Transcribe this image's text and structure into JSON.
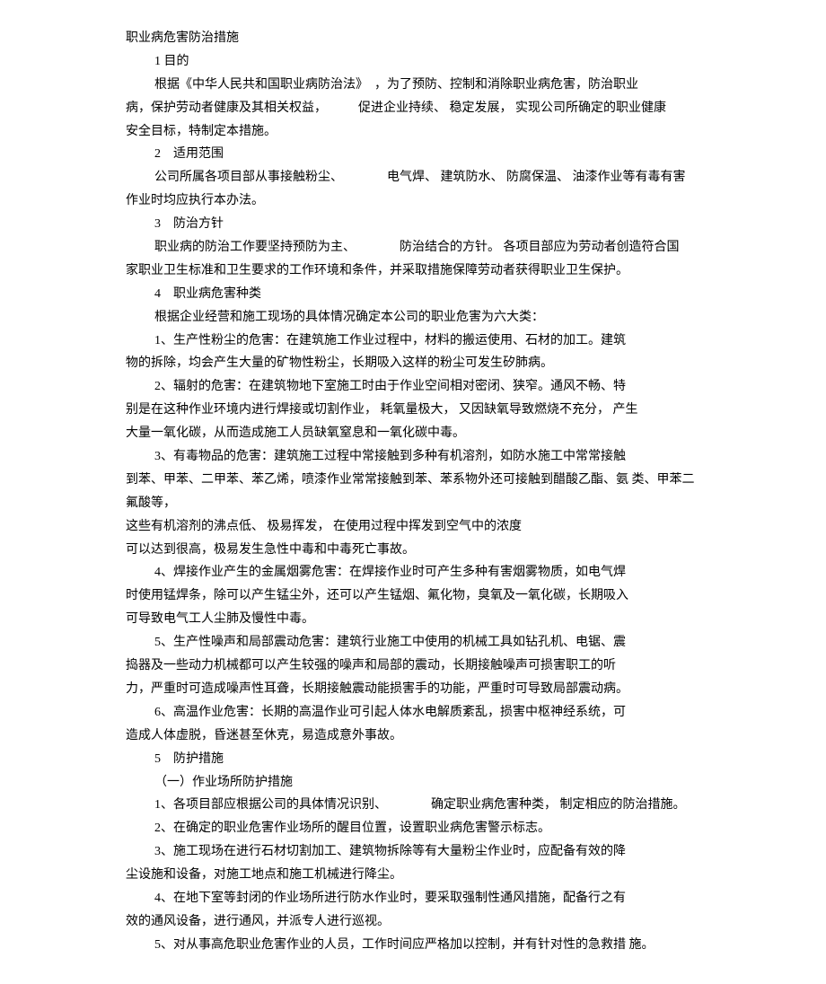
{
  "title": "职业病危害防治措施",
  "sections": {
    "s1": {
      "head": "1 目的",
      "p1": "根据《中华人民共和国职业病防治法》　，为了预防、控制和消除职业病危害，防治职业",
      "p2": "病，保护劳动者健康及其相关权益，　　　促进企业持续、 稳定发展， 实现公司所确定的职业健康",
      "p3": "安全目标，特制定本措施。"
    },
    "s2": {
      "head": "2　适用范围",
      "p1": "公司所属各项目部从事接触粉尘、　　　　电气焊、 建筑防水、 防腐保温、 油漆作业等有毒有害",
      "p2": "作业时均应执行本办法。"
    },
    "s3": {
      "head": "3　防治方针",
      "p1": "职业病的防治工作要坚持预防为主、　　　　防治结合的方针。 各项目部应为劳动者创造符合国",
      "p2": "家职业卫生标准和卫生要求的工作环境和条件，并采取措施保障劳动者获得职业卫生保护。"
    },
    "s4": {
      "head": "4　职业病危害种类",
      "intro": "根据企业经营和施工现场的具体情况确定本公司的职业危害为六大类：",
      "item1a": "1、生产性粉尘的危害：在建筑施工作业过程中，材料的搬运使用、石材的加工。建筑",
      "item1b": "物的拆除，均会产生大量的矿物性粉尘，长期吸入这样的粉尘可发生矽肺病。",
      "item2a": "2、辐射的危害：在建筑物地下室施工时由于作业空间相对密闭、狭窄。通风不畅、特",
      "item2b": "别是在这种作业环境内进行焊接或切割作业， 耗氧量极大， 又因缺氧导致燃烧不充分， 产生",
      "item2c": "大量一氧化碳，从而造成施工人员缺氧窒息和一氧化碳中毒。",
      "item3a": "3、有毒物品的危害：建筑施工过程中常接触到多种有机溶剂，如防水施工中常常接触",
      "item3b": "到苯、甲苯、二甲苯、苯乙烯，喷漆作业常常接触到苯、苯系物外还可接触到醋酸乙酯、氨 类、甲苯二氟酸等，",
      "item3c": "这些有机溶剂的沸点低、 极易挥发， 在使用过程中挥发到空气中的浓度",
      "item3d": "可以达到很高，极易发生急性中毒和中毒死亡事故。",
      "item4a": "4、焊接作业产生的金属烟雾危害：在焊接作业时可产生多种有害烟雾物质，如电气焊",
      "item4b": "时使用锰焊条，除可以产生锰尘外，还可以产生锰烟、氟化物，臭氧及一氧化碳，长期吸入",
      "item4c": "可导致电气工人尘肺及慢性中毒。",
      "item5a": "5、生产性噪声和局部震动危害：建筑行业施工中使用的机械工具如钻孔机、电锯、震",
      "item5b": "捣器及一些动力机械都可以产生较强的噪声和局部的震动，长期接触噪声可损害职工的听",
      "item5c": "力，严重时可造成噪声性耳聋，长期接触震动能损害手的功能，严重时可导致局部震动病。",
      "item6a": "6、高温作业危害：长期的高温作业可引起人体水电解质紊乱，损害中枢神经系统，可",
      "item6b": "造成人体虚脱，昏迷甚至休克，易造成意外事故。"
    },
    "s5": {
      "head": "5　防护措施",
      "sub": "（一）作业场所防护措施",
      "item1": "1、各项目部应根据公司的具体情况识别、　　　　确定职业病危害种类， 制定相应的防治措施。",
      "item2": "2、在确定的职业危害作业场所的醒目位置，设置职业病危害警示标志。",
      "item3a": "3、施工现场在进行石材切割加工、建筑物拆除等有大量粉尘作业时，应配备有效的降",
      "item3b": "尘设施和设备，对施工地点和施工机械进行降尘。",
      "item4a": "4、在地下室等封闭的作业场所进行防水作业时，要采取强制性通风措施，配备行之有",
      "item4b": "效的通风设备，进行通风，并派专人进行巡视。",
      "item5": "5、对从事高危职业危害作业的人员，工作时间应严格加以控制，并有针对性的急救措 施。"
    }
  }
}
